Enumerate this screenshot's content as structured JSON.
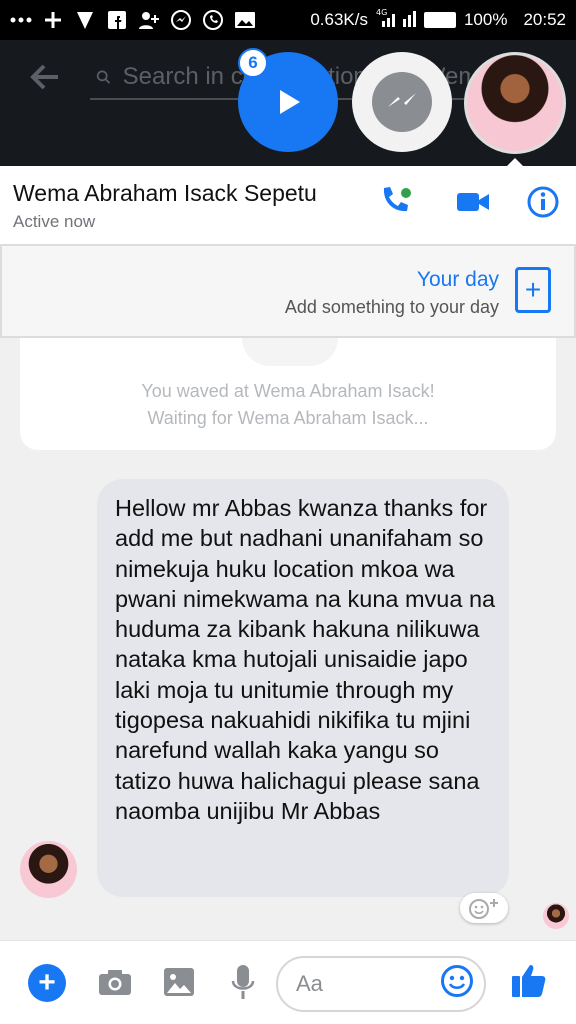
{
  "status_bar": {
    "speed": "0.63K/s",
    "battery": "100%",
    "time": "20:52",
    "network": "4G"
  },
  "search": {
    "placeholder": "Search in conversation with Wema Abraham Isack Sepetu"
  },
  "chat_heads": {
    "badge_count": "6"
  },
  "conversation": {
    "name": "Wema Abraham Isack Sepetu",
    "status": "Active now"
  },
  "your_day": {
    "title": "Your day",
    "subtitle": "Add something to your day"
  },
  "wave": {
    "line1": "You waved at Wema Abraham Isack!",
    "line2": "Waiting for Wema Abraham Isack..."
  },
  "message": {
    "text": "Hellow mr Abbas  kwanza thanks for add me but nadhani unanifaham so nimekuja huku location mkoa wa pwani nimekwama na kuna mvua na huduma za kibank hakuna nilikuwa nataka kma hutojali unisaidie japo laki moja tu unitumie through my tigopesa nakuahidi nikifika tu mjini narefund wallah kaka yangu so tatizo huwa halichagui please sana naomba unijibu Mr Abbas"
  },
  "composer": {
    "placeholder": "Aa"
  },
  "colors": {
    "accent": "#1877f2",
    "online": "#31a24c"
  }
}
